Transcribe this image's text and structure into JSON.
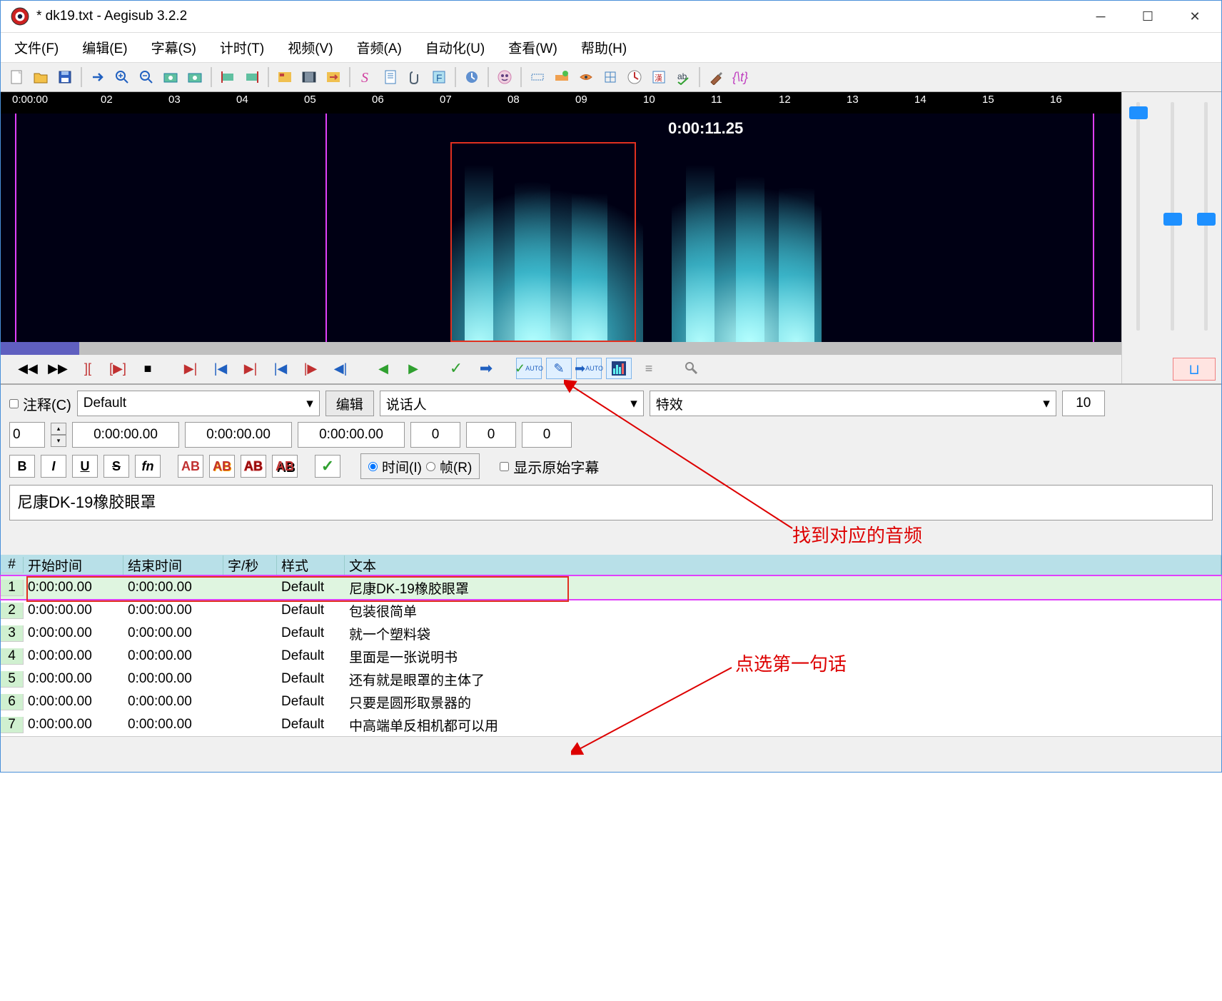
{
  "window": {
    "title": "* dk19.txt - Aegisub 3.2.2"
  },
  "menu": {
    "file": "文件(F)",
    "edit": "编辑(E)",
    "subs": "字幕(S)",
    "timing": "计时(T)",
    "video": "视频(V)",
    "audio": "音频(A)",
    "auto": "自动化(U)",
    "view": "查看(W)",
    "help": "帮助(H)"
  },
  "audio": {
    "time_marker": "0:00:11.25",
    "ruler_start": "0:00:00",
    "ticks": [
      "02",
      "03",
      "04",
      "05",
      "06",
      "07",
      "08",
      "09",
      "10",
      "11",
      "12",
      "13",
      "14",
      "15",
      "16"
    ]
  },
  "edit": {
    "comment_label": "注释(C)",
    "style_value": "Default",
    "edit_btn": "编辑",
    "speaker_placeholder": "说话人",
    "effect_placeholder": "特效",
    "margin_value": "10",
    "layer": "0",
    "start_time": "0:00:00.00",
    "end_time": "0:00:00.00",
    "duration": "0:00:00.00",
    "chars1": "0",
    "chars2": "0",
    "chars3": "0",
    "bold": "B",
    "italic": "I",
    "underline": "U",
    "strike": "S",
    "font": "fn",
    "ab1": "AB",
    "ab2": "AB",
    "ab3": "AB",
    "ab4": "AB",
    "time_radio": "时间(I)",
    "frame_radio": "帧(R)",
    "show_orig": "显示原始字幕",
    "main_text": "尼康DK-19橡胶眼罩"
  },
  "grid": {
    "headers": {
      "num": "#",
      "start": "开始时间",
      "end": "结束时间",
      "chars": "字/秒",
      "style": "样式",
      "text": "文本"
    },
    "rows": [
      {
        "n": "1",
        "start": "0:00:00.00",
        "end": "0:00:00.00",
        "style": "Default",
        "text": "尼康DK-19橡胶眼罩"
      },
      {
        "n": "2",
        "start": "0:00:00.00",
        "end": "0:00:00.00",
        "style": "Default",
        "text": "包装很简单"
      },
      {
        "n": "3",
        "start": "0:00:00.00",
        "end": "0:00:00.00",
        "style": "Default",
        "text": "就一个塑料袋"
      },
      {
        "n": "4",
        "start": "0:00:00.00",
        "end": "0:00:00.00",
        "style": "Default",
        "text": "里面是一张说明书"
      },
      {
        "n": "5",
        "start": "0:00:00.00",
        "end": "0:00:00.00",
        "style": "Default",
        "text": "还有就是眼罩的主体了"
      },
      {
        "n": "6",
        "start": "0:00:00.00",
        "end": "0:00:00.00",
        "style": "Default",
        "text": "只要是圆形取景器的"
      },
      {
        "n": "7",
        "start": "0:00:00.00",
        "end": "0:00:00.00",
        "style": "Default",
        "text": "中高端单反相机都可以用"
      }
    ]
  },
  "annotations": {
    "audio_hint": "找到对应的音频",
    "row_hint": "点选第一句话"
  }
}
